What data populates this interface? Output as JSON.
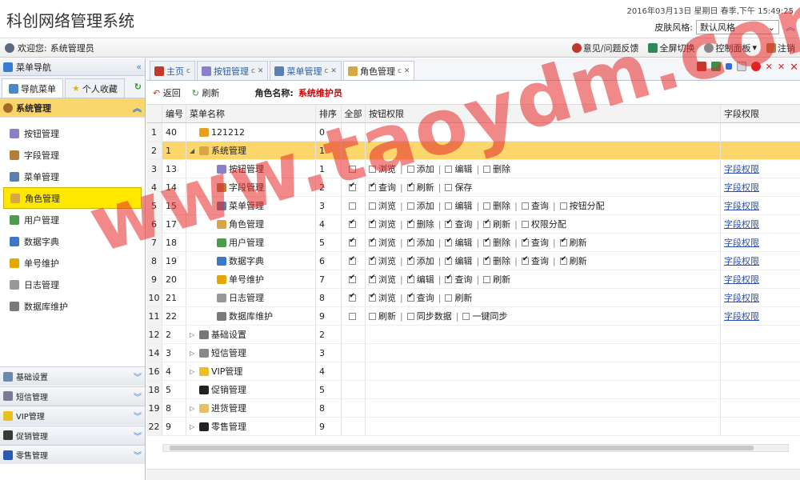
{
  "header": {
    "title": "科创网络管理系统",
    "datetime": "2016年03月13日 星期日 春季,下午 15:49:25",
    "skin_label": "皮肤风格:",
    "skin_value": "默认风格"
  },
  "topbar": {
    "welcome": "欢迎您:",
    "user": "系统管理员",
    "tools": [
      "意见/问题反馈",
      "全屏切换",
      "控制面板",
      "注销"
    ]
  },
  "sidebar": {
    "title": "菜单导航",
    "tabs": [
      "导航菜单",
      "个人收藏"
    ],
    "active_section": "系统管理",
    "items": [
      {
        "label": "按钮管理",
        "color": "#8a7fc9"
      },
      {
        "label": "字段管理",
        "color": "#b77b3a"
      },
      {
        "label": "菜单管理",
        "color": "#5a7fb0"
      },
      {
        "label": "角色管理",
        "color": "#d9a646"
      },
      {
        "label": "用户管理",
        "color": "#4f9a4f"
      },
      {
        "label": "数据字典",
        "color": "#3d78c8"
      },
      {
        "label": "单号维护",
        "color": "#e0a800"
      },
      {
        "label": "日志管理",
        "color": "#999999"
      },
      {
        "label": "数据库维护",
        "color": "#7a7a7a"
      }
    ],
    "bottom_sections": [
      "基础设置",
      "短信管理",
      "VIP管理",
      "促销管理",
      "零售管理"
    ]
  },
  "tabs": [
    {
      "label": "主页",
      "active": false
    },
    {
      "label": "按钮管理",
      "active": false
    },
    {
      "label": "菜单管理",
      "active": false
    },
    {
      "label": "角色管理",
      "active": true
    }
  ],
  "toolbar": {
    "back": "返回",
    "refresh": "刷新",
    "role_label": "角色名称:",
    "role_value": "系统维护员"
  },
  "table": {
    "headers": [
      "编号",
      "菜单名称",
      "排序",
      "全部",
      "按钮权限",
      "字段权限"
    ],
    "rows": [
      {
        "n": "1",
        "id": "40",
        "name": "121212",
        "order": "0",
        "indent": 0,
        "arrow": "",
        "icon": "#e8a020",
        "all": null,
        "perms": [],
        "field": ""
      },
      {
        "n": "2",
        "id": "1",
        "name": "系统管理",
        "order": "1",
        "indent": 0,
        "arrow": "◢",
        "icon": "#d9a646",
        "all": null,
        "perms": [],
        "field": "",
        "hl": true
      },
      {
        "n": "3",
        "id": "13",
        "name": "按钮管理",
        "order": "1",
        "indent": 1,
        "arrow": "",
        "icon": "#8a7fc9",
        "all": false,
        "perms": [
          [
            "浏览",
            false
          ],
          [
            "添加",
            false
          ],
          [
            "编辑",
            false
          ],
          [
            "删除",
            false
          ]
        ],
        "field": "字段权限"
      },
      {
        "n": "4",
        "id": "14",
        "name": "字段管理",
        "order": "2",
        "indent": 1,
        "arrow": "",
        "icon": "#b77b3a",
        "all": true,
        "perms": [
          [
            "查询",
            true
          ],
          [
            "刷新",
            true
          ],
          [
            "保存",
            false
          ]
        ],
        "field": "字段权限"
      },
      {
        "n": "5",
        "id": "15",
        "name": "菜单管理",
        "order": "3",
        "indent": 1,
        "arrow": "",
        "icon": "#5a7fb0",
        "all": false,
        "perms": [
          [
            "浏览",
            false
          ],
          [
            "添加",
            false
          ],
          [
            "编辑",
            false
          ],
          [
            "删除",
            false
          ],
          [
            "查询",
            false
          ],
          [
            "按钮分配",
            false
          ]
        ],
        "field": "字段权限"
      },
      {
        "n": "6",
        "id": "17",
        "name": "角色管理",
        "order": "4",
        "indent": 1,
        "arrow": "",
        "icon": "#d9a646",
        "all": true,
        "perms": [
          [
            "浏览",
            true
          ],
          [
            "删除",
            true
          ],
          [
            "查询",
            true
          ],
          [
            "刷新",
            true
          ],
          [
            "权限分配",
            false
          ]
        ],
        "field": "字段权限"
      },
      {
        "n": "7",
        "id": "18",
        "name": "用户管理",
        "order": "5",
        "indent": 1,
        "arrow": "",
        "icon": "#4f9a4f",
        "all": true,
        "perms": [
          [
            "浏览",
            true
          ],
          [
            "添加",
            true
          ],
          [
            "编辑",
            true
          ],
          [
            "删除",
            true
          ],
          [
            "查询",
            true
          ],
          [
            "刷新",
            true
          ]
        ],
        "field": "字段权限"
      },
      {
        "n": "8",
        "id": "19",
        "name": "数据字典",
        "order": "6",
        "indent": 1,
        "arrow": "",
        "icon": "#3d78c8",
        "all": true,
        "perms": [
          [
            "浏览",
            true
          ],
          [
            "添加",
            true
          ],
          [
            "编辑",
            true
          ],
          [
            "删除",
            true
          ],
          [
            "查询",
            true
          ],
          [
            "刷新",
            true
          ]
        ],
        "field": "字段权限"
      },
      {
        "n": "9",
        "id": "20",
        "name": "单号维护",
        "order": "7",
        "indent": 1,
        "arrow": "",
        "icon": "#e0a800",
        "all": true,
        "perms": [
          [
            "浏览",
            true
          ],
          [
            "编辑",
            true
          ],
          [
            "查询",
            true
          ],
          [
            "刷新",
            false
          ]
        ],
        "field": "字段权限"
      },
      {
        "n": "10",
        "id": "21",
        "name": "日志管理",
        "order": "8",
        "indent": 1,
        "arrow": "",
        "icon": "#999999",
        "all": true,
        "perms": [
          [
            "浏览",
            true
          ],
          [
            "查询",
            true
          ],
          [
            "刷新",
            false
          ]
        ],
        "field": "字段权限"
      },
      {
        "n": "11",
        "id": "22",
        "name": "数据库维护",
        "order": "9",
        "indent": 1,
        "arrow": "",
        "icon": "#7a7a7a",
        "all": false,
        "perms": [
          [
            "刷新",
            false
          ],
          [
            "同步数据",
            false
          ],
          [
            "一键同步",
            false
          ]
        ],
        "field": "字段权限"
      },
      {
        "n": "12",
        "id": "2",
        "name": "基础设置",
        "order": "2",
        "indent": 0,
        "arrow": "▷",
        "icon": "#777777",
        "all": null,
        "perms": [],
        "field": ""
      },
      {
        "n": "14",
        "id": "3",
        "name": "短信管理",
        "order": "3",
        "indent": 0,
        "arrow": "▷",
        "icon": "#888888",
        "all": null,
        "perms": [],
        "field": ""
      },
      {
        "n": "16",
        "id": "4",
        "name": "VIP管理",
        "order": "4",
        "indent": 0,
        "arrow": "▷",
        "icon": "#e8c020",
        "all": null,
        "perms": [],
        "field": ""
      },
      {
        "n": "18",
        "id": "5",
        "name": "促销管理",
        "order": "5",
        "indent": 0,
        "arrow": "",
        "icon": "#222222",
        "all": null,
        "perms": [],
        "field": ""
      },
      {
        "n": "19",
        "id": "8",
        "name": "进货管理",
        "order": "8",
        "indent": 0,
        "arrow": "▷",
        "icon": "#e8c060",
        "all": null,
        "perms": [],
        "field": ""
      },
      {
        "n": "22",
        "id": "9",
        "name": "零售管理",
        "order": "9",
        "indent": 0,
        "arrow": "▷",
        "icon": "#222222",
        "all": null,
        "perms": [],
        "field": ""
      }
    ]
  },
  "watermark": "www.taoydm.com"
}
